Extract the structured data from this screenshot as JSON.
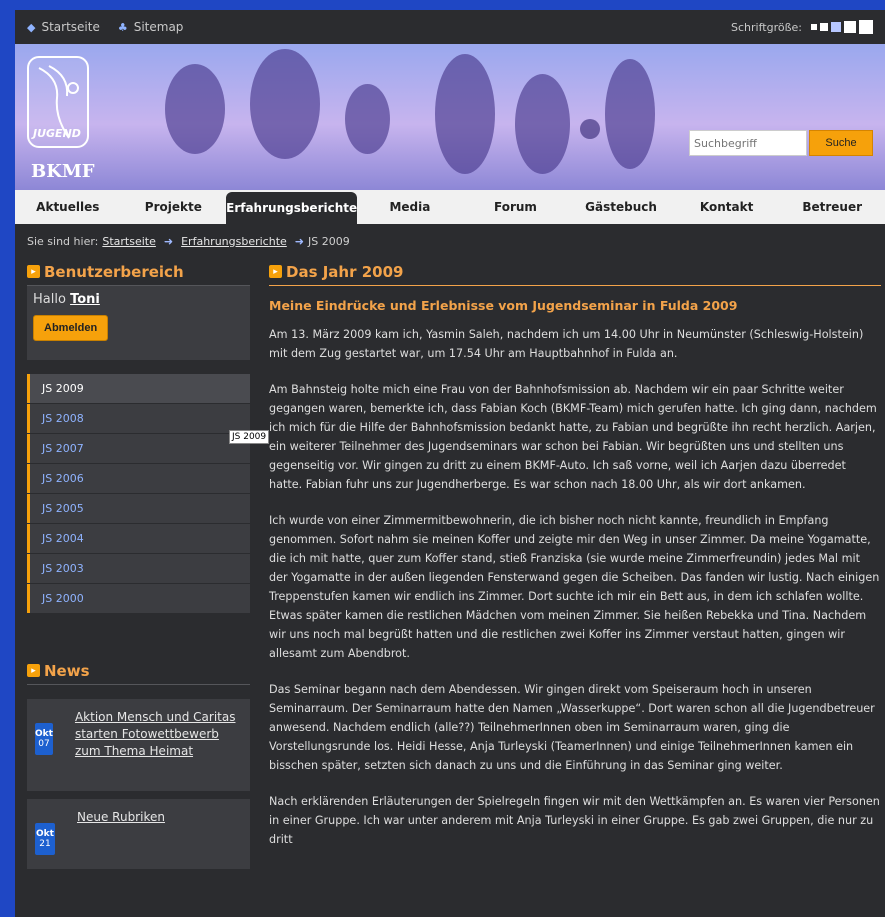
{
  "topbar": {
    "home_label": "Startseite",
    "sitemap_label": "Sitemap",
    "fontsize_label": "Schriftgröße:"
  },
  "brand": {
    "name": "BKMF",
    "logo_text": "JUGEND"
  },
  "search": {
    "placeholder": "Suchbegriff",
    "button_label": "Suche"
  },
  "nav": {
    "items": [
      {
        "label": "Aktuelles"
      },
      {
        "label": "Projekte"
      },
      {
        "label": "Erfahrungsberichte"
      },
      {
        "label": "Media"
      },
      {
        "label": "Forum"
      },
      {
        "label": "Gästebuch"
      },
      {
        "label": "Kontakt"
      },
      {
        "label": "Betreuer"
      }
    ],
    "active_index": 2
  },
  "breadcrumb": {
    "prefix": "Sie sind hier:",
    "items": [
      "Startseite",
      "Erfahrungsberichte",
      "JS 2009"
    ]
  },
  "sidebar": {
    "user_title": "Benutzerbereich",
    "hello": "Hallo",
    "username": "Toni",
    "logout_label": "Abmelden",
    "js_items": [
      "JS 2009",
      "JS 2008",
      "JS 2007",
      "JS 2006",
      "JS 2005",
      "JS 2004",
      "JS 2003",
      "JS 2000"
    ],
    "tooltip": "JS 2009",
    "news_title": "News",
    "news": [
      {
        "month": "Okt",
        "day": "07",
        "text": "Aktion Mensch und Caritas starten Fotowettbewerb zum Thema Heimat"
      },
      {
        "month": "Okt",
        "day": "21",
        "text": "Neue Rubriken"
      }
    ]
  },
  "main": {
    "title": "Das Jahr 2009",
    "subtitle": "Meine Eindrücke und Erlebnisse vom Jugendseminar in Fulda 2009",
    "paragraphs": [
      "Am 13. März 2009 kam ich, Yasmin Saleh, nachdem ich um 14.00 Uhr in Neumünster (Schleswig-Holstein) mit dem Zug gestartet war, um 17.54 Uhr am Hauptbahnhof in Fulda an.",
      "Am Bahnsteig holte mich eine Frau von der Bahnhofsmission ab. Nachdem wir ein paar Schritte weiter gegangen waren, bemerkte ich, dass Fabian Koch (BKMF-Team) mich gerufen hatte. Ich ging dann, nachdem ich mich für die Hilfe der Bahnhofsmission bedankt hatte, zu Fabian und begrüßte ihn recht herzlich. Aarjen, ein weiterer Teilnehmer des Jugendseminars war schon bei Fabian. Wir begrüßten uns und stellten uns gegenseitig vor. Wir gingen zu dritt zu einem BKMF-Auto. Ich saß vorne, weil ich Aarjen dazu überredet hatte. Fabian fuhr uns zur Jugendherberge. Es war schon nach 18.00 Uhr, als wir dort ankamen.",
      "Ich wurde von einer Zimmermitbewohnerin, die ich bisher noch nicht kannte, freundlich in Empfang genommen. Sofort nahm sie meinen Koffer und zeigte mir den Weg in unser Zimmer. Da meine Yogamatte, die ich mit hatte, quer zum Koffer stand, stieß Franziska (sie wurde meine Zimmerfreundin) jedes Mal mit der Yogamatte in der außen liegenden Fensterwand gegen die Scheiben. Das fanden wir lustig. Nach einigen Treppenstufen kamen wir endlich ins Zimmer. Dort suchte ich mir ein Bett aus, in dem ich schlafen wollte. Etwas später kamen die restlichen Mädchen vom meinen Zimmer. Sie heißen Rebekka und Tina. Nachdem wir uns noch mal begrüßt hatten und die restlichen zwei Koffer ins Zimmer verstaut hatten, gingen wir allesamt zum Abendbrot.",
      "Das Seminar begann nach dem Abendessen. Wir gingen direkt vom Speiseraum hoch in unseren Seminarraum. Der Seminarraum hatte den Namen „Wasserkuppe“. Dort waren schon all die Jugendbetreuer anwesend. Nachdem endlich (alle??) TeilnehmerInnen oben im Seminarraum waren, ging die Vorstellungsrunde los. Heidi Hesse, Anja Turleyski (TeamerInnen) und einige TeilnehmerInnen kamen ein bisschen später, setzten sich danach zu uns und die Einführung in das Seminar ging weiter.",
      "Nach erklärenden Erläuterungen der Spielregeln fingen wir mit den Wettkämpfen an. Es waren vier Personen in einer Gruppe. Ich war unter anderem mit Anja Turleyski in einer Gruppe. Es gab zwei Gruppen, die nur zu dritt"
    ]
  },
  "colors": {
    "accent": "#f6a10b",
    "background": "#2b2c2f",
    "frame": "#1f47c4"
  }
}
